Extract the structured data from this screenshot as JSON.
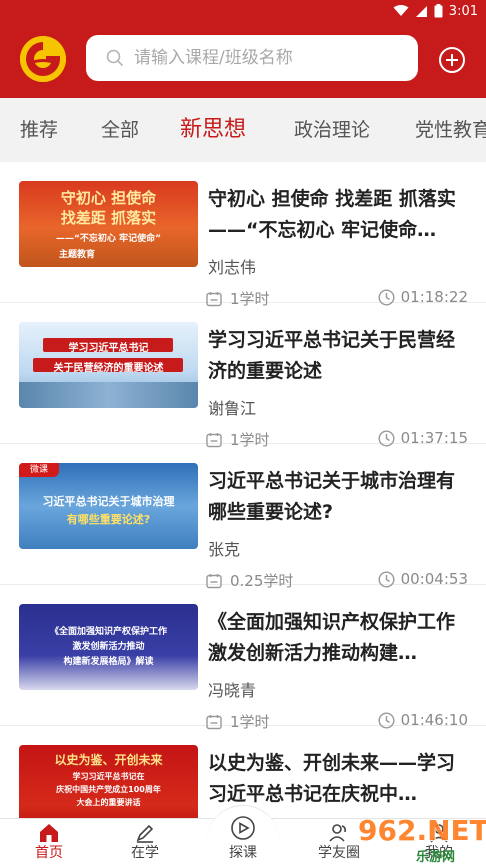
{
  "status_bar": {
    "time": "3:01"
  },
  "search": {
    "placeholder": "请输入课程/班级名称"
  },
  "tabs": [
    {
      "label": "推荐"
    },
    {
      "label": "全部"
    },
    {
      "label": "新思想",
      "active": true
    },
    {
      "label": "政治理论"
    },
    {
      "label": "党性教育"
    }
  ],
  "courses": [
    {
      "title": "守初心 担使命 找差距 抓落实 ——“不忘初心 牢记使命…",
      "author": "刘志伟",
      "hours": "1学时",
      "duration": "01:18:22",
      "thumb": {
        "line1": "守初心  担使命",
        "line2": "找差距  抓落实",
        "line3": "——“不忘初心 牢记使命”",
        "line4": "主题教育"
      }
    },
    {
      "title": "学习习近平总书记关于民营经济的重要论述",
      "author": "谢鲁江",
      "hours": "1学时",
      "duration": "01:37:15",
      "thumb": {
        "line1": "学习习近平总书记",
        "line2": "关于民营经济的重要论述"
      }
    },
    {
      "title": "习近平总书记关于城市治理有哪些重要论述?",
      "author": "张克",
      "hours": "0.25学时",
      "duration": "00:04:53",
      "thumb": {
        "badge": "微课",
        "line1": "习近平总书记关于城市治理",
        "line2": "有哪些重要论述?"
      }
    },
    {
      "title": "《全面加强知识产权保护工作 激发创新活力推动构建…",
      "author": "冯晓青",
      "hours": "1学时",
      "duration": "01:46:10",
      "thumb": {
        "line1": "《全面加强知识产权保护工作",
        "line2": "激发创新活力推动",
        "line3": "构建新发展格局》解读"
      }
    },
    {
      "title": "以史为鉴、开创未来——学习习近平总书记在庆祝中…",
      "author": "",
      "hours": "",
      "duration": "",
      "thumb": {
        "line1": "以史为鉴、开创未来",
        "line2": "学习习近平总书记在",
        "line3": "庆祝中国共产党成立100周年",
        "line4": "大会上的重要讲话"
      }
    }
  ],
  "bottom_nav": [
    {
      "label": "首页",
      "active": true
    },
    {
      "label": "在学"
    },
    {
      "label": "探课"
    },
    {
      "label": "学友圈"
    },
    {
      "label": "我的"
    }
  ],
  "watermark": {
    "text": "962.NET",
    "sub": "乐游网"
  },
  "colors": {
    "brand_red": "#c71a1a",
    "logo_yellow": "#f7c400",
    "tab_bg": "#f2f2f2"
  }
}
